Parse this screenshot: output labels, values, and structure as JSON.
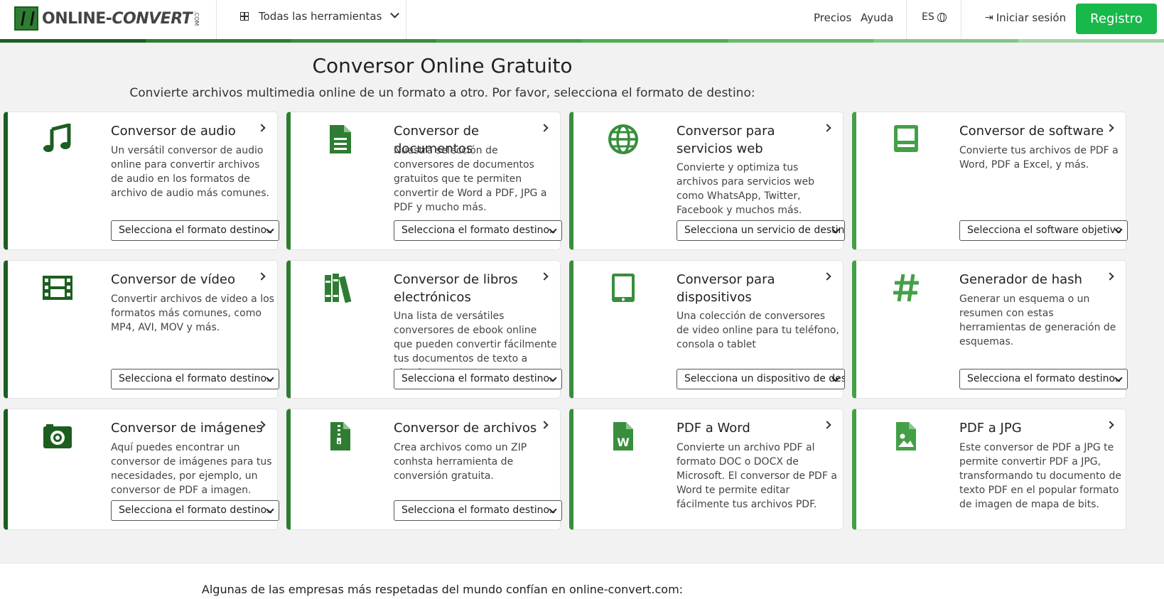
{
  "header": {
    "logo_text_a": "ONLINE-",
    "logo_text_b": "CONVERT",
    "logo_com": ".COM",
    "tools_menu": "Todas las herramientas",
    "pricing": "Precios",
    "help": "Ayuda",
    "language": "ES",
    "login": "Iniciar sesión",
    "register": "Registro"
  },
  "stripe_colors": [
    "#1b5e20",
    "#2e7d32",
    "#388e3c",
    "#43a047",
    "#4caf50",
    "#66bb6a",
    "#81c784",
    "#a5d6a7"
  ],
  "hero": {
    "title": "Conversor Online Gratuito",
    "subtitle": "Convierte archivos multimedia online de un formato a otro. Por favor, selecciona el formato de destino:"
  },
  "cards": [
    {
      "title": "Conversor de audio",
      "desc": "Un versátil conversor de audio online para convertir archivos de audio en los formatos de archivo de audio más comunes.",
      "select": "Selecciona el formato destino..",
      "icon": "music-note-icon",
      "color": "#1b5e20"
    },
    {
      "title": "Conversor de documentos",
      "desc": "Nuestra selección de conversores de documentos gratuitos que te permiten convertir de Word a PDF, JPG a PDF y mucho más.",
      "select": "Selecciona el formato destino..",
      "icon": "document-icon",
      "color": "#2e7d32"
    },
    {
      "title": "Conversor para servicios web",
      "desc": "Convierte y optimiza tus archivos para servicios web como WhatsApp, Twitter, Facebook y muchos más.",
      "select": "Selecciona un servicio de destino",
      "icon": "globe-icon",
      "color": "#388e3c"
    },
    {
      "title": "Conversor de software",
      "desc": "Convierte tus archivos de PDF a Word, PDF a Excel, y más.",
      "select": "Selecciona el software objetivo",
      "icon": "computer-icon",
      "color": "#43a047"
    },
    {
      "title": "Conversor de vídeo",
      "desc": "Convertir archivos de video a los formatos más comunes, como MP4, AVI, MOV y más.",
      "select": "Selecciona el formato destino..",
      "icon": "film-icon",
      "color": "#1b5e20"
    },
    {
      "title": "Conversor de libros electrónicos",
      "desc": "Una lista de versátiles conversores de ebook online que pueden convertir fácilmente tus documentos de texto a ebook.",
      "select": "Selecciona el formato destino.",
      "icon": "books-icon",
      "color": "#2e7d32"
    },
    {
      "title": "Conversor para dispositivos",
      "desc": "Una colección de conversores de video online para tu teléfono, consola o tablet",
      "select": "Selecciona un dispositivo de destino",
      "icon": "tablet-icon",
      "color": "#388e3c"
    },
    {
      "title": "Generador de hash",
      "desc": "Generar un esquema o un resumen con estas herramientas de generación de esquemas.",
      "select": "Selecciona el formato destino..",
      "icon": "hash-icon",
      "color": "#43a047"
    },
    {
      "title": "Conversor de imágenes",
      "desc": "Aquí puedes encontrar un conversor de imágenes para tus necesidades, por ejemplo, un conversor de PDF a imagen.",
      "select": "Selecciona el formato destino..",
      "icon": "camera-icon",
      "color": "#1b5e20"
    },
    {
      "title": "Conversor de archivos",
      "desc": "Crea archivos como un ZIP conhsta herramienta de conversión gratuita.",
      "select": "Selecciona el formato destino..",
      "icon": "zip-file-icon",
      "color": "#2e7d32"
    },
    {
      "title": "PDF a Word",
      "desc": "Convierte un archivo PDF al formato DOC o DOCX de Microsoft. El conversor de PDF a Word te permite editar fácilmente tus archivos PDF.",
      "select": "",
      "icon": "word-file-icon",
      "color": "#388e3c"
    },
    {
      "title": "PDF a JPG",
      "desc": "Este conversor de PDF a JPG te permite convertir PDF a JPG, transformando tu documento de texto PDF en el popular formato de imagen de mapa de bits.",
      "select": "",
      "icon": "image-file-icon",
      "color": "#43a047"
    }
  ],
  "footer": {
    "trust_text": "Algunas de las empresas más respetadas del mundo confían en online-convert.com:"
  }
}
